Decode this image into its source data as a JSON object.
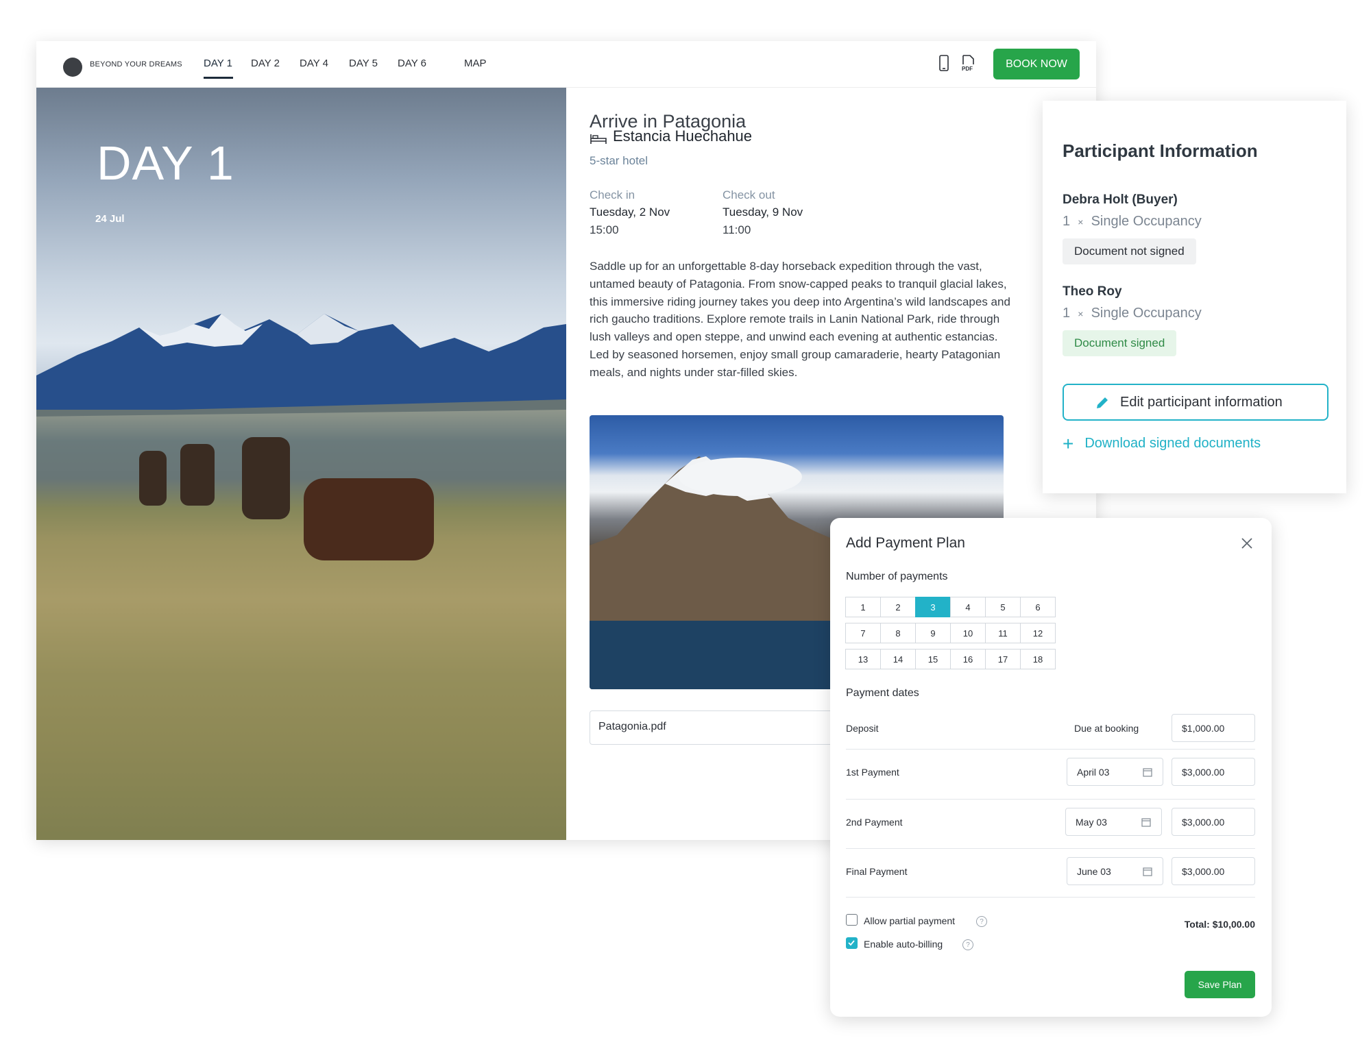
{
  "header": {
    "brand": "BEYOND YOUR DREAMS",
    "tabs": [
      "DAY 1",
      "DAY 2",
      "DAY 4",
      "DAY 5",
      "DAY 6",
      "MAP"
    ],
    "active_tab": "DAY 1",
    "book_label": "BOOK NOW",
    "icons": [
      "phone-icon",
      "pdf-icon"
    ]
  },
  "hero": {
    "day": "DAY 1",
    "date": "24 Jul"
  },
  "content": {
    "title": "Arrive in Patagonia",
    "hotel_name": "Estancia Huechahue",
    "hotel_type": "5-star hotel",
    "check_in_label": "Check in",
    "check_in_day": "Tuesday, 2 Nov",
    "check_in_time": "15:00",
    "check_out_label": "Check out",
    "check_out_day": "Tuesday, 9 Nov",
    "check_out_time": "11:00",
    "description": "Saddle up for an unforgettable 8-day horseback expedition through the vast, untamed beauty of Patagonia. From snow-capped peaks to tranquil glacial lakes, this immersive riding journey takes you deep into Argentina’s wild landscapes and rich gaucho traditions. Explore remote trails in Lanin National Park, ride through lush valleys and open steppe, and unwind each evening at authentic estancias. Led by seasoned horsemen, enjoy small group camaraderie, hearty Patagonian meals, and nights under star-filled skies.",
    "file_name": "Patagonia.pdf"
  },
  "participants": {
    "title": "Participant Information",
    "people": [
      {
        "name": "Debra Holt (Buyer)",
        "qty": "1",
        "times": "×",
        "occupancy": "Single Occupancy",
        "status": "Document not signed"
      },
      {
        "name": "Theo Roy",
        "qty": "1",
        "times": "×",
        "occupancy": "Single Occupancy",
        "status": "Document signed"
      }
    ],
    "edit_label": "Edit participant information",
    "download_label": "Download signed documents"
  },
  "payment": {
    "title": "Add Payment Plan",
    "number_label": "Number of payments",
    "numbers": [
      "1",
      "2",
      "3",
      "4",
      "5",
      "6",
      "7",
      "8",
      "9",
      "10",
      "11",
      "12",
      "13",
      "14",
      "15",
      "16",
      "17",
      "18"
    ],
    "selected": "3",
    "dates_label": "Payment dates",
    "deposit": {
      "label": "Deposit",
      "due": "Due at booking",
      "amount": "$1,000.00"
    },
    "rows": [
      {
        "label": "1st Payment",
        "date": "April 03",
        "amount": "$3,000.00"
      },
      {
        "label": "2nd Payment",
        "date": "May 03",
        "amount": "$3,000.00"
      },
      {
        "label": "Final Payment",
        "date": "June 03",
        "amount": "$3,000.00"
      }
    ],
    "allow_partial_label": "Allow partial payment",
    "allow_partial_checked": false,
    "auto_billing_label": "Enable auto-billing",
    "auto_billing_checked": true,
    "help_glyph": "?",
    "total": "Total: $10,00.00",
    "save_label": "Save Plan"
  },
  "colors": {
    "accent": "#22b2c8",
    "primary_green": "#27a54a",
    "signed_bg": "#e6f5e9",
    "signed_text": "#2f8a46"
  }
}
